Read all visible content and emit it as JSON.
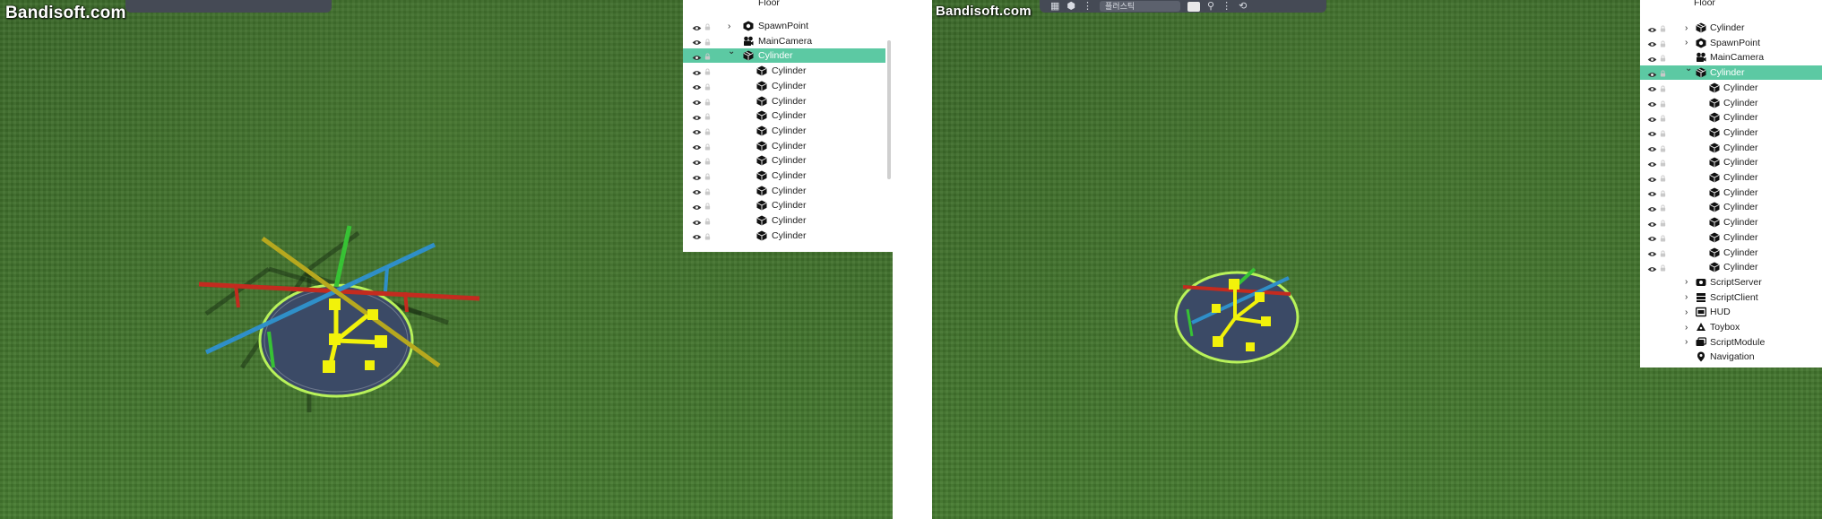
{
  "watermark": "Bandisoft.com",
  "left_pane": {
    "top_partial_label": "Floor",
    "explorer_items": [
      {
        "label": "SpawnPoint",
        "icon": "spawn-icon",
        "depth": 0,
        "arrow": "collapsed",
        "selected": false
      },
      {
        "label": "MainCamera",
        "icon": "camera-icon",
        "depth": 0,
        "arrow": "none",
        "selected": false
      },
      {
        "label": "Cylinder",
        "icon": "model-icon",
        "depth": 0,
        "arrow": "expanded",
        "selected": true
      },
      {
        "label": "Cylinder",
        "icon": "part-icon",
        "depth": 1,
        "arrow": "none",
        "selected": false
      },
      {
        "label": "Cylinder",
        "icon": "part-icon",
        "depth": 1,
        "arrow": "none",
        "selected": false
      },
      {
        "label": "Cylinder",
        "icon": "part-icon",
        "depth": 1,
        "arrow": "none",
        "selected": false
      },
      {
        "label": "Cylinder",
        "icon": "part-icon",
        "depth": 1,
        "arrow": "none",
        "selected": false
      },
      {
        "label": "Cylinder",
        "icon": "part-icon",
        "depth": 1,
        "arrow": "none",
        "selected": false
      },
      {
        "label": "Cylinder",
        "icon": "part-icon",
        "depth": 1,
        "arrow": "none",
        "selected": false
      },
      {
        "label": "Cylinder",
        "icon": "part-icon",
        "depth": 1,
        "arrow": "none",
        "selected": false
      },
      {
        "label": "Cylinder",
        "icon": "part-icon",
        "depth": 1,
        "arrow": "none",
        "selected": false
      },
      {
        "label": "Cylinder",
        "icon": "part-icon",
        "depth": 1,
        "arrow": "none",
        "selected": false
      },
      {
        "label": "Cylinder",
        "icon": "part-icon",
        "depth": 1,
        "arrow": "none",
        "selected": false
      },
      {
        "label": "Cylinder",
        "icon": "part-icon",
        "depth": 1,
        "arrow": "none",
        "selected": false
      },
      {
        "label": "Cylinder",
        "icon": "part-icon",
        "depth": 1,
        "arrow": "none",
        "selected": false
      }
    ]
  },
  "right_pane": {
    "toolbar": {
      "field_text": "플러스틱"
    },
    "top_partial_label": "Floor",
    "explorer_items": [
      {
        "label": "Cylinder",
        "icon": "model-icon",
        "depth": 0,
        "arrow": "collapsed",
        "selected": false
      },
      {
        "label": "SpawnPoint",
        "icon": "spawn-icon",
        "depth": 0,
        "arrow": "collapsed",
        "selected": false
      },
      {
        "label": "MainCamera",
        "icon": "camera-icon",
        "depth": 0,
        "arrow": "none",
        "selected": false
      },
      {
        "label": "Cylinder",
        "icon": "model-icon",
        "depth": 0,
        "arrow": "expanded",
        "selected": true
      },
      {
        "label": "Cylinder",
        "icon": "part-icon",
        "depth": 1,
        "arrow": "none",
        "selected": false
      },
      {
        "label": "Cylinder",
        "icon": "part-icon",
        "depth": 1,
        "arrow": "none",
        "selected": false
      },
      {
        "label": "Cylinder",
        "icon": "part-icon",
        "depth": 1,
        "arrow": "none",
        "selected": false
      },
      {
        "label": "Cylinder",
        "icon": "part-icon",
        "depth": 1,
        "arrow": "none",
        "selected": false
      },
      {
        "label": "Cylinder",
        "icon": "part-icon",
        "depth": 1,
        "arrow": "none",
        "selected": false
      },
      {
        "label": "Cylinder",
        "icon": "part-icon",
        "depth": 1,
        "arrow": "none",
        "selected": false
      },
      {
        "label": "Cylinder",
        "icon": "part-icon",
        "depth": 1,
        "arrow": "none",
        "selected": false
      },
      {
        "label": "Cylinder",
        "icon": "part-icon",
        "depth": 1,
        "arrow": "none",
        "selected": false
      },
      {
        "label": "Cylinder",
        "icon": "part-icon",
        "depth": 1,
        "arrow": "none",
        "selected": false
      },
      {
        "label": "Cylinder",
        "icon": "part-icon",
        "depth": 1,
        "arrow": "none",
        "selected": false
      },
      {
        "label": "Cylinder",
        "icon": "part-icon",
        "depth": 1,
        "arrow": "none",
        "selected": false
      },
      {
        "label": "Cylinder",
        "icon": "part-icon",
        "depth": 1,
        "arrow": "none",
        "selected": false
      },
      {
        "label": "Cylinder",
        "icon": "part-icon",
        "depth": 1,
        "arrow": "none",
        "selected": false
      },
      {
        "label": "ScriptServer",
        "icon": "script-server-icon",
        "depth": 0,
        "arrow": "collapsed",
        "selected": false,
        "no_eye": true
      },
      {
        "label": "ScriptClient",
        "icon": "script-client-icon",
        "depth": 0,
        "arrow": "collapsed",
        "selected": false,
        "no_eye": true
      },
      {
        "label": "HUD",
        "icon": "hud-icon",
        "depth": 0,
        "arrow": "collapsed",
        "selected": false,
        "no_eye": true
      },
      {
        "label": "Toybox",
        "icon": "toybox-icon",
        "depth": 0,
        "arrow": "collapsed",
        "selected": false,
        "no_eye": true
      },
      {
        "label": "ScriptModule",
        "icon": "script-module-icon",
        "depth": 0,
        "arrow": "collapsed",
        "selected": false,
        "no_eye": true
      },
      {
        "label": "Navigation",
        "icon": "navigation-icon",
        "depth": 0,
        "arrow": "none",
        "selected": false,
        "no_eye": true
      }
    ]
  },
  "colors": {
    "grass": "#3f6f2b",
    "selection": "#5cc9a3",
    "toolbar": "#454a55",
    "gizmo_yellow": "#f2f20a",
    "gizmo_green": "#37c234",
    "gizmo_red": "#c42b1f",
    "gizmo_blue": "#2f8fc8",
    "gizmo_olive": "#b7a81e",
    "selection_ring": "#b8f25a"
  }
}
